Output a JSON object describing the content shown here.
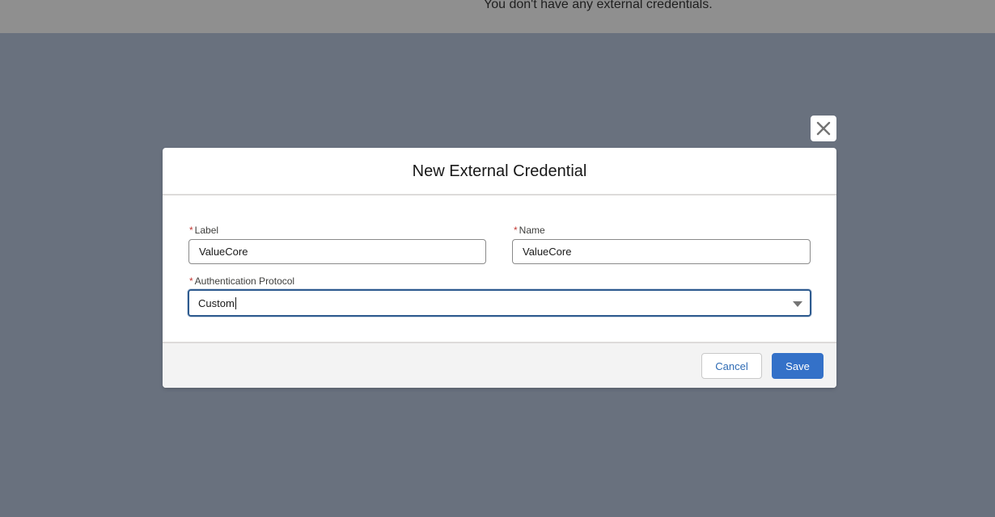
{
  "background": {
    "empty_message": "You don't have any external credentials."
  },
  "modal": {
    "title": "New External Credential",
    "close_icon": "close-icon",
    "fields": {
      "label": {
        "required_marker": "*",
        "label": "Label",
        "value": "ValueCore"
      },
      "name": {
        "required_marker": "*",
        "label": "Name",
        "value": "ValueCore"
      },
      "auth_protocol": {
        "required_marker": "*",
        "label": "Authentication Protocol",
        "value": "Custom"
      }
    },
    "footer": {
      "cancel_label": "Cancel",
      "save_label": "Save"
    }
  },
  "colors": {
    "overlay": "#69717e",
    "brand_button": "#3471c8",
    "required": "#c23934",
    "focus_border": "#2e5b8f"
  }
}
